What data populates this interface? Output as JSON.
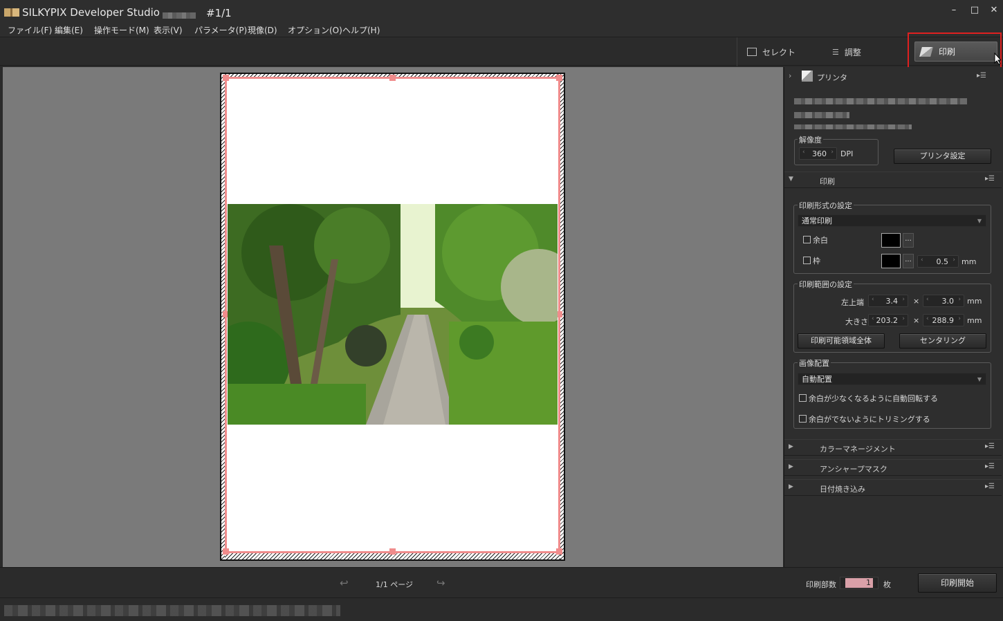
{
  "window": {
    "title": "SILKYPIX Developer Studio",
    "doc_index": "#1/1",
    "minimize": "–",
    "maximize": "□",
    "close": "✕"
  },
  "menu": [
    "ファイル(F)",
    "編集(E)",
    "操作モード(M)",
    "表示(V)",
    "パラメータ(P)",
    "現像(D)",
    "オプション(O)",
    "ヘルプ(H)"
  ],
  "modes": {
    "select": "セレクト",
    "adjust": "調整",
    "print": "印刷"
  },
  "printer": {
    "header": "プリンタ",
    "resolution_label": "解像度",
    "resolution_value": "360",
    "resolution_unit": "DPI",
    "settings_button": "プリンタ設定"
  },
  "print_section": {
    "header": "印刷",
    "format_group": "印刷形式の設定",
    "format_value": "通常印刷",
    "margin_check": "余白",
    "frame_check": "枠",
    "frame_width": "0.5",
    "unit_mm": "mm",
    "range_group": "印刷範囲の設定",
    "top_left_label": "左上端",
    "top_left_x": "3.4",
    "top_left_y": "3.0",
    "size_label": "大きさ",
    "size_w": "203.2",
    "size_h": "288.9",
    "times": "×",
    "full_area_button": "印刷可能領域全体",
    "center_button": "センタリング",
    "layout_group": "画像配置",
    "layout_value": "自動配置",
    "auto_rotate_check": "余白が少なくなるように自動回転する",
    "trim_check": "余白がでないようにトリミングする"
  },
  "collapsed_sections": [
    "カラーマネージメント",
    "アンシャープマスク",
    "日付焼き込み"
  ],
  "bottom": {
    "page_indicator": "1/1 ページ",
    "copies_label": "印刷部数",
    "copies_value": "1",
    "copies_unit": "枚",
    "start_button": "印刷開始"
  },
  "colors": {
    "margin_line": "#f08c8c",
    "highlight": "#e02020",
    "canvas": "#7a7a7a"
  },
  "icons": {
    "expand": "›",
    "collapsed": "▶",
    "expanded": "▼",
    "menu": "▸☰",
    "prev_page": "↩",
    "next_page": "↪"
  }
}
